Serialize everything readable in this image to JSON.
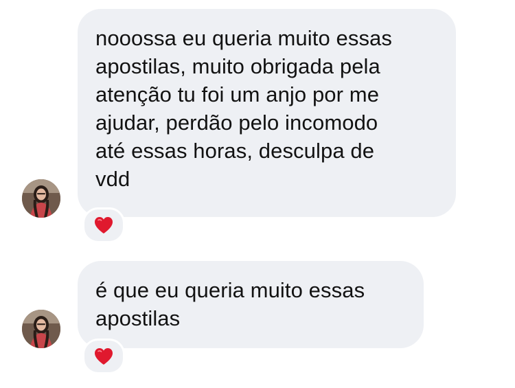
{
  "messages": [
    {
      "text": "nooossa eu queria muito essas\napostilas, muito obrigada pela\natenção tu foi um anjo por me\najudar, perdão pelo incomodo\naté essas horas, desculpa de\nvdd",
      "reaction_icon": "red-heart-icon"
    },
    {
      "text": "é que eu queria muito essas\napostilas",
      "reaction_icon": "red-heart-icon"
    }
  ],
  "colors": {
    "bubble_background": "#eef0f4",
    "text": "#121212",
    "heart": "#e0192e"
  }
}
